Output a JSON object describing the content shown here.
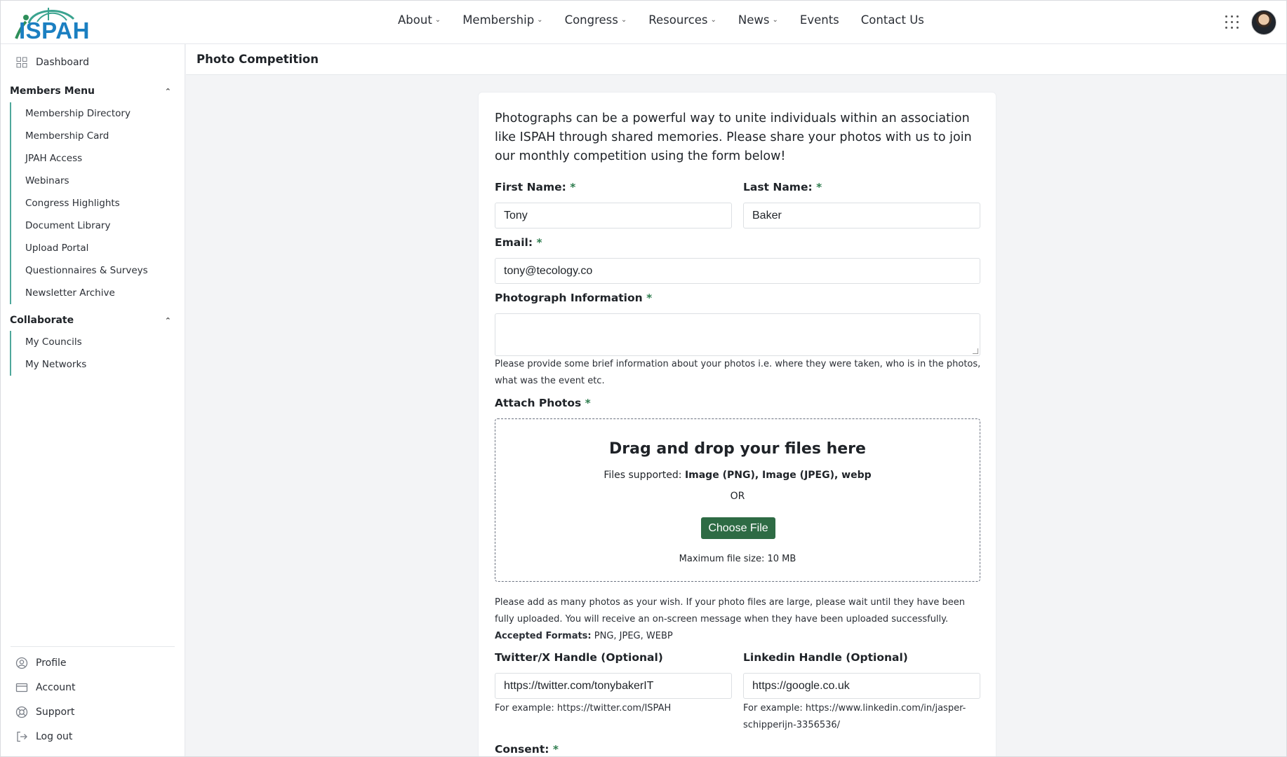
{
  "header": {
    "logo_text": "ISPAH",
    "nav": [
      {
        "label": "About",
        "dropdown": true
      },
      {
        "label": "Membership",
        "dropdown": true
      },
      {
        "label": "Congress",
        "dropdown": true
      },
      {
        "label": "Resources",
        "dropdown": true
      },
      {
        "label": "News",
        "dropdown": true
      },
      {
        "label": "Events",
        "dropdown": false
      },
      {
        "label": "Contact Us",
        "dropdown": false
      }
    ]
  },
  "sidebar": {
    "dashboard": {
      "label": "Dashboard",
      "icon": "grid-icon"
    },
    "members_menu": {
      "title": "Members Menu",
      "items": [
        "Membership Directory",
        "Membership Card",
        "JPAH Access",
        "Webinars",
        "Congress Highlights",
        "Document Library",
        "Upload Portal",
        "Questionnaires & Surveys",
        "Newsletter Archive"
      ]
    },
    "collaborate": {
      "title": "Collaborate",
      "items": [
        "My Councils",
        "My Networks"
      ]
    },
    "bottom": [
      {
        "label": "Profile",
        "icon": "user-circle-icon"
      },
      {
        "label": "Account",
        "icon": "credit-card-icon"
      },
      {
        "label": "Support",
        "icon": "lifebuoy-icon"
      },
      {
        "label": "Log out",
        "icon": "logout-icon"
      }
    ]
  },
  "page": {
    "title": "Photo Competition",
    "intro": "Photographs can be a powerful way to unite individuals within an association like ISPAH through shared memories. Please share your photos with us to join our monthly competition using the form below!",
    "required_mark": "*",
    "first_name": {
      "label": "First Name:",
      "value": "Tony"
    },
    "last_name": {
      "label": "Last Name:",
      "value": "Baker"
    },
    "email": {
      "label": "Email:",
      "value": "tony@tecology.co"
    },
    "photo_info": {
      "label": "Photograph Information",
      "value": "",
      "help": "Please provide some brief information about your photos i.e. where they were taken, who is in the photos, what was the event etc."
    },
    "attach": {
      "label": "Attach Photos",
      "dz_title": "Drag and drop your files here",
      "supported_prefix": "Files supported: ",
      "supported_types": "Image (PNG), Image (JPEG), webp",
      "or": "OR",
      "choose_button": "Choose File",
      "max_size": "Maximum file size: 10 MB",
      "help": "Please add as many photos as your wish. If your photo files are large, please wait until they have been fully uploaded. You will receive an on-screen message when they have been uploaded successfully.",
      "accepted_label": "Accepted Formats:",
      "accepted_value": " PNG, JPEG, WEBP"
    },
    "twitter": {
      "label": "Twitter/X Handle (Optional)",
      "value": "https://twitter.com/tonybakerIT",
      "help": "For example: https://twitter.com/ISPAH"
    },
    "linkedin": {
      "label": "Linkedin Handle (Optional)",
      "value": "https://google.co.uk",
      "help": "For example: https://www.linkedin.com/in/jasper-schipperijn-3356536/"
    },
    "consent": {
      "label": "Consent:"
    }
  },
  "colors": {
    "brand_blue": "#1b7fc1",
    "brand_green": "#2e6b44",
    "sidebar_accent": "#4fa89b"
  }
}
